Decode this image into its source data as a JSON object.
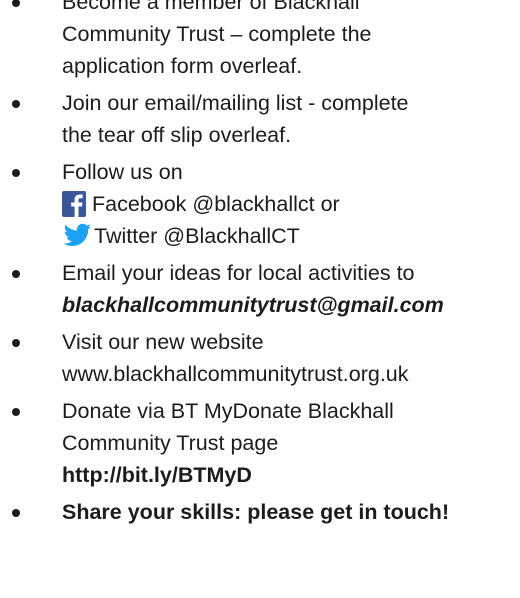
{
  "items": [
    {
      "lines": [
        "Become a member of Blackhall",
        "Community Trust – complete the",
        "application form overleaf."
      ]
    },
    {
      "lines": [
        "Join our email/mailing list - complete",
        "the tear off slip overleaf."
      ]
    },
    {
      "intro": "Follow us on",
      "facebook": {
        "icon": "facebook-icon",
        "text": "Facebook @blackhallct or"
      },
      "twitter": {
        "icon": "twitter-icon",
        "text": "Twitter @BlackhallCT"
      }
    },
    {
      "line1": "Email your ideas for local activities to",
      "email": "blackhallcommunitytrust@gmail.com"
    },
    {
      "lines": [
        "Visit our new website",
        "www.blackhallcommunitytrust.org.uk"
      ]
    },
    {
      "lines": [
        "Donate via BT MyDonate Blackhall",
        "Community Trust page"
      ],
      "link": "http://bit.ly/BTMyD"
    },
    {
      "text": "Share your skills: please get in touch!"
    }
  ],
  "colors": {
    "text": "#1c1c1c",
    "facebook": "#3b5998",
    "twitter": "#1da1f2"
  }
}
